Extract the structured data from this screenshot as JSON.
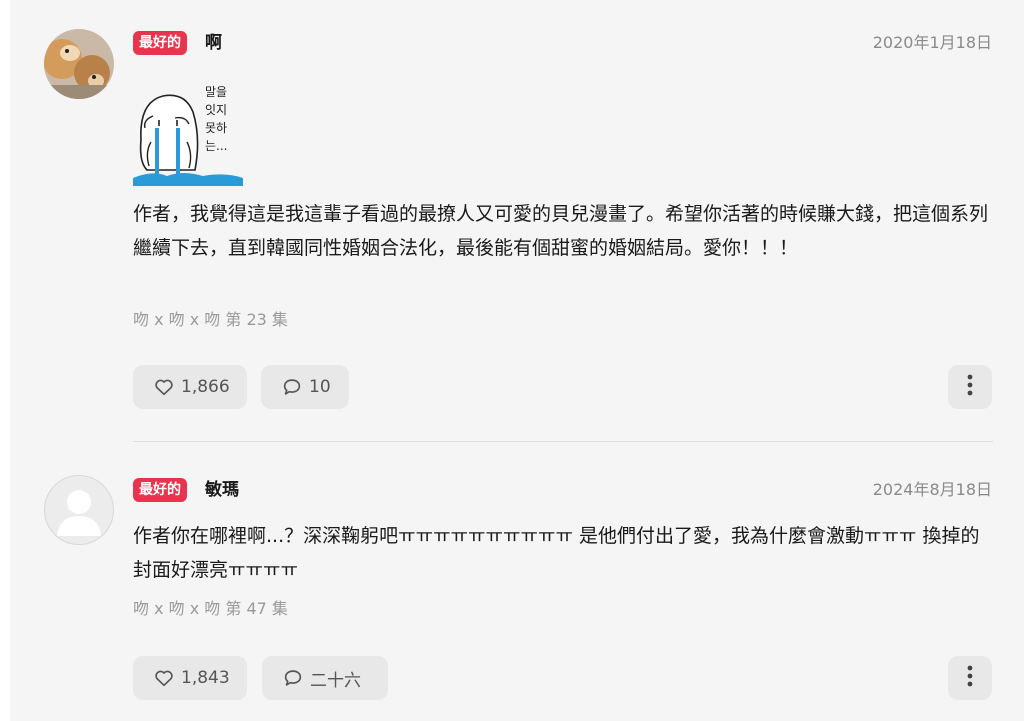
{
  "comments": [
    {
      "badge": "最好的",
      "username": "啊",
      "date": "2020年1月18日",
      "sticker_text": [
        "말을",
        "잇지",
        "못하",
        "는..."
      ],
      "text": "作者，我覺得這是我這輩子看過的最撩人又可愛的貝兒漫畫了。希望你活著的時候賺大錢，把這個系列繼續下去，直到韓國同性婚姻合法化，最後能有個甜蜜的婚姻結局。愛你！！！",
      "episode": "吻 x 吻 x 吻 第 23 集",
      "likes": "1,866",
      "replies": "10"
    },
    {
      "badge": "最好的",
      "username": "敏瑪",
      "date": "2024年8月18日",
      "text": "作者你在哪裡啊...？深深鞠躬吧ㅠㅠㅠㅠㅠㅠㅠㅠㅠㅠ 是他們付出了愛，我為什麼會激動ㅠㅠㅠ 換掉的封面好漂亮ㅠㅠㅠㅠ",
      "episode": "吻 x 吻 x 吻 第 47 集",
      "likes": "1,843",
      "replies": "二十六"
    }
  ],
  "colors": {
    "badge": "#e8344c",
    "background": "#f5f5f5",
    "pill": "#e8e8e8"
  },
  "icons": {
    "like": "heart-icon",
    "reply": "speech-bubble-icon",
    "more": "vertical-dots-icon"
  }
}
